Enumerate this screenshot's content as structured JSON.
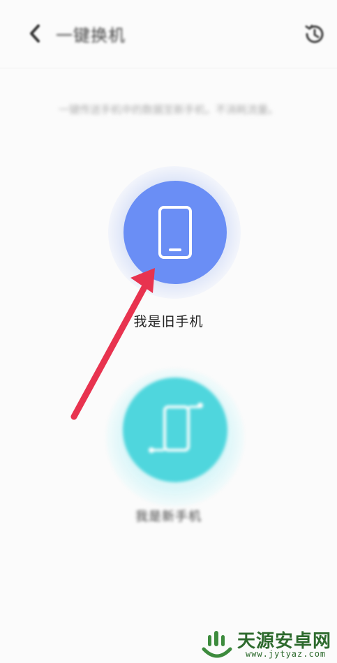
{
  "header": {
    "title": "一键换机",
    "back_icon": "chevron-left-icon",
    "history_icon": "history-clock-icon"
  },
  "subtitle": "一键传送手机中的数据至新手机，不消耗流量。",
  "options": [
    {
      "label": "我是旧手机",
      "icon": "phone-icon",
      "color": "#6a8ef5"
    },
    {
      "label": "我是新手机",
      "icon": "phone-swap-icon",
      "color": "#4fd6dd"
    }
  ],
  "annotation": {
    "arrow_color": "#e8334f"
  },
  "watermark": {
    "name": "天源安卓网",
    "url": "www.jytyaz.com"
  }
}
